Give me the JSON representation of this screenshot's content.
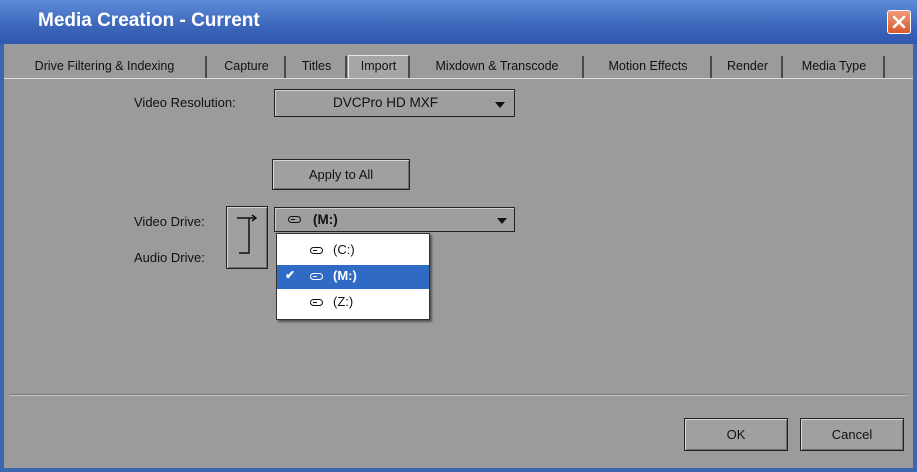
{
  "window": {
    "title": "Media Creation - Current"
  },
  "tabs": [
    "Drive Filtering & Indexing",
    "Capture",
    "Titles",
    "Import",
    "Mixdown & Transcode",
    "Motion Effects",
    "Render",
    "Media Type"
  ],
  "active_tab": "Import",
  "form": {
    "video_resolution_label": "Video Resolution:",
    "video_resolution_value": "DVCPro HD  MXF",
    "apply_to_all_label": "Apply to All",
    "video_drive_label": "Video Drive:",
    "audio_drive_label": "Audio Drive:",
    "video_drive_value": "(M:)"
  },
  "drive_menu": {
    "options": [
      "(C:)",
      "(M:)",
      "(Z:)"
    ],
    "selected": "(M:)",
    "check_glyph": "✔"
  },
  "footer": {
    "ok_label": "OK",
    "cancel_label": "Cancel"
  },
  "colors": {
    "titlebar": "#3c66ba",
    "selection": "#2f6bc5",
    "close": "#d85a30"
  }
}
